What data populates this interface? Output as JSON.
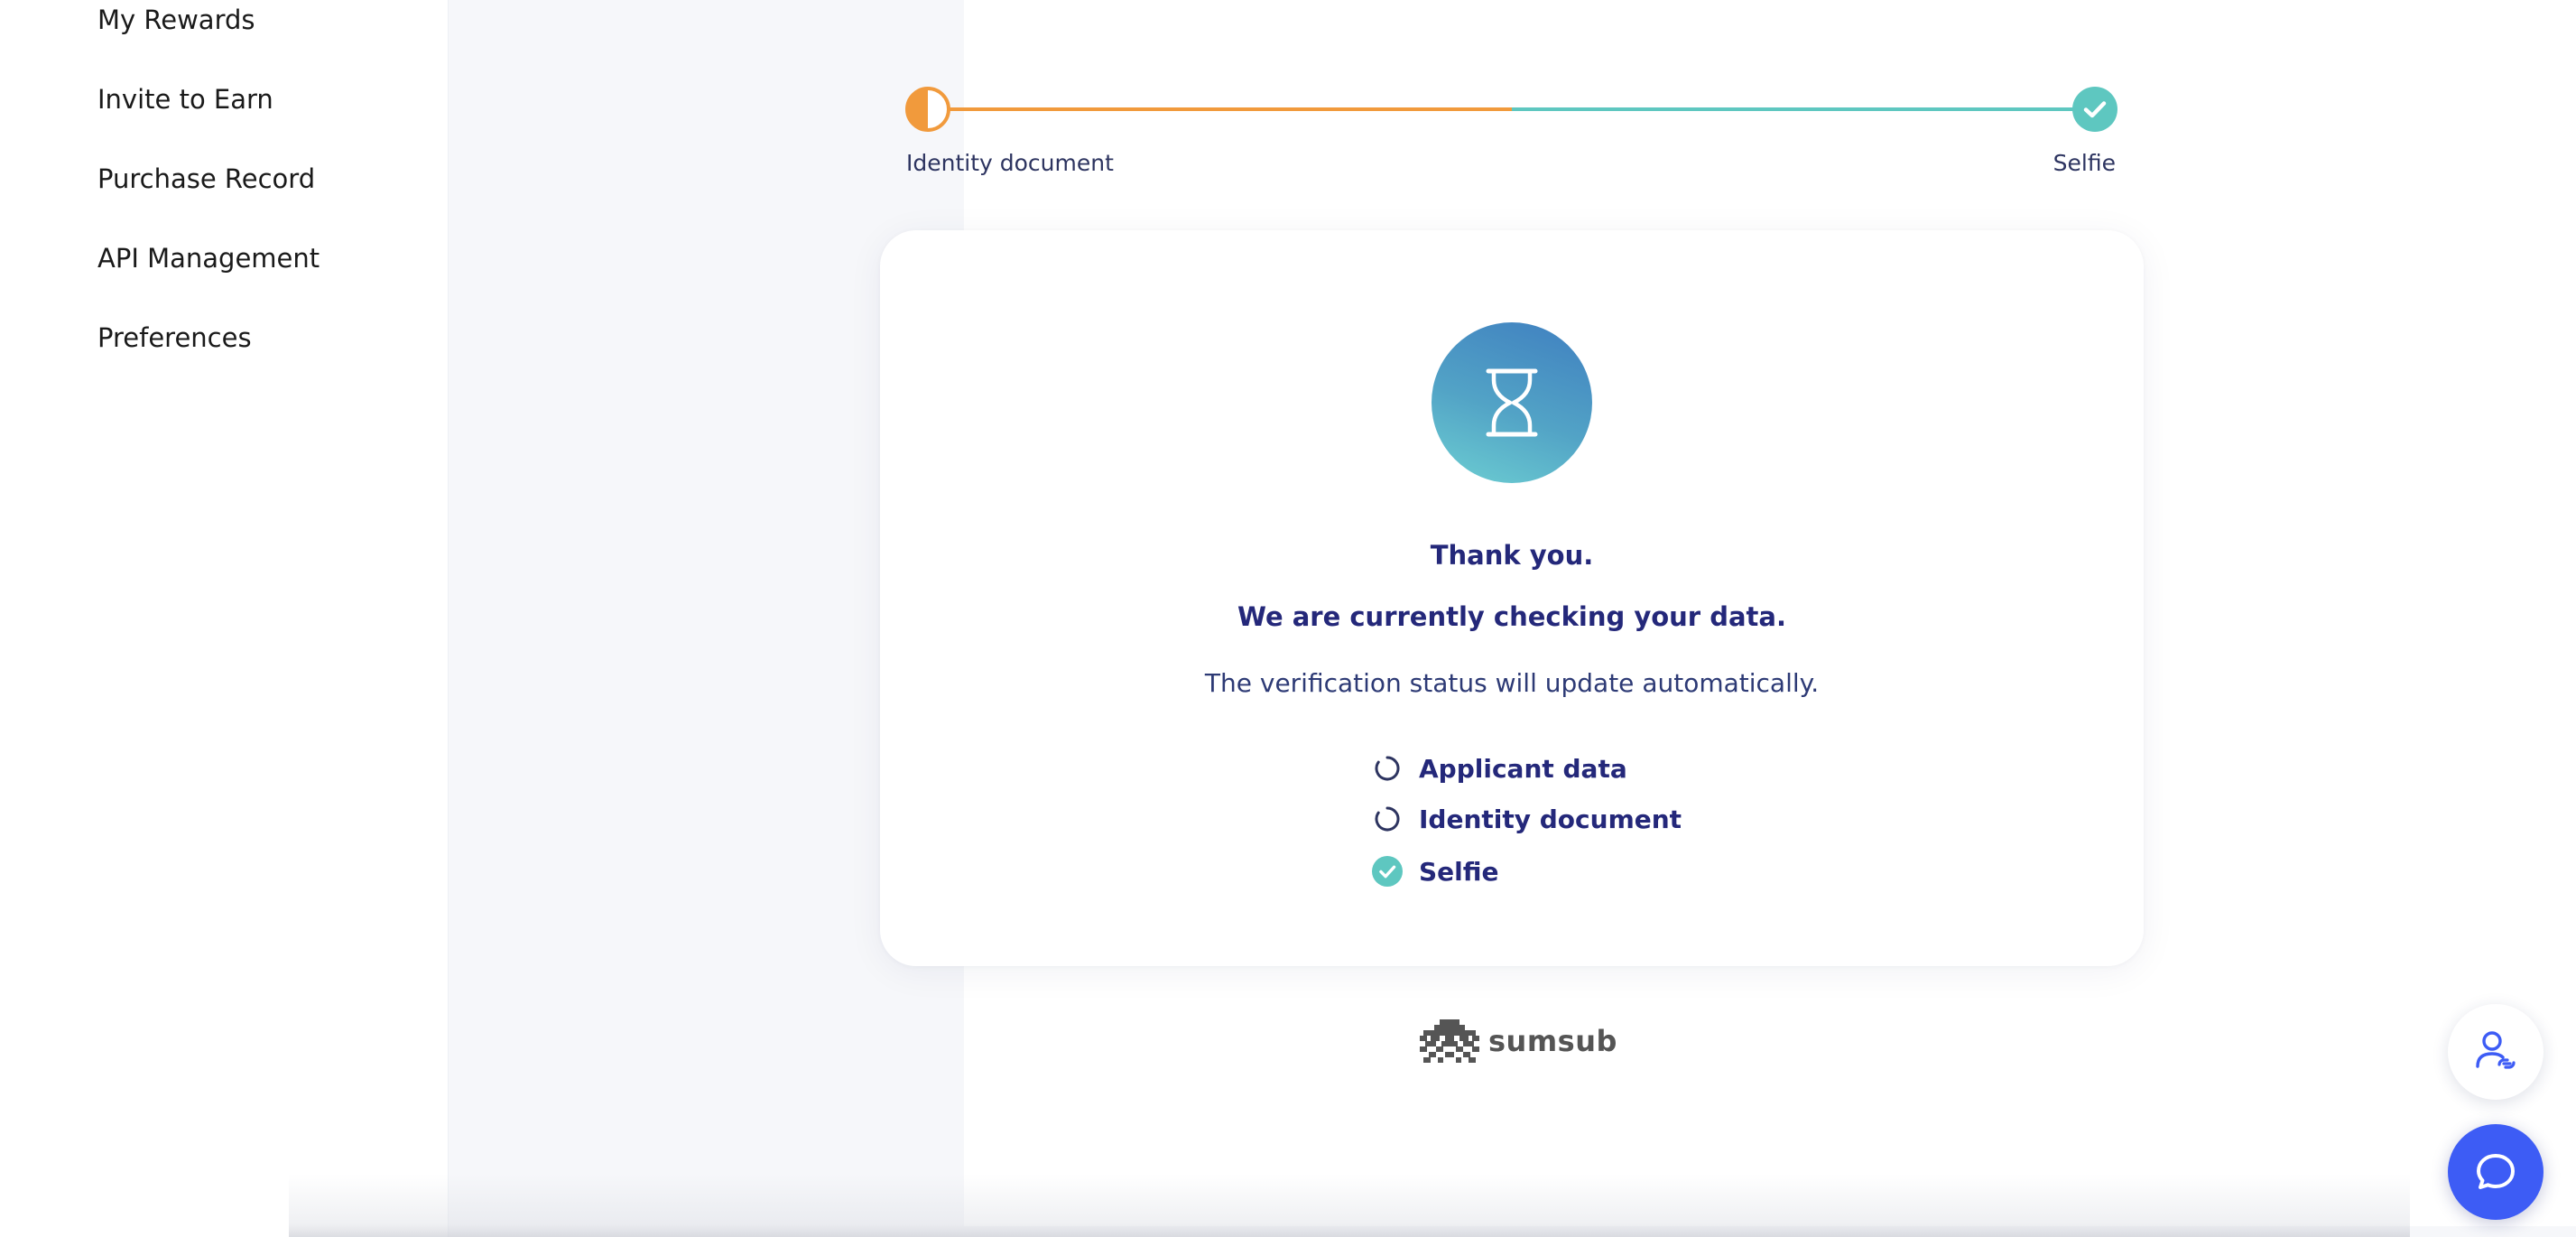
{
  "sidebar": {
    "items": [
      {
        "label": "My Rewards"
      },
      {
        "label": "Invite to Earn"
      },
      {
        "label": "Purchase Record"
      },
      {
        "label": "API Management"
      },
      {
        "label": "Preferences"
      }
    ]
  },
  "stepper": {
    "steps": [
      {
        "label": "Identity document",
        "state": "in-progress"
      },
      {
        "label": "Selfie",
        "state": "completed"
      }
    ]
  },
  "verification": {
    "icon": "hourglass-icon",
    "title": "Thank you.",
    "headline": "We are currently checking your data.",
    "message": "The verification status will update automatically.",
    "checklist": [
      {
        "label": "Applicant data",
        "status": "pending",
        "icon": "loading-ring-icon"
      },
      {
        "label": "Identity document",
        "status": "pending",
        "icon": "loading-ring-icon"
      },
      {
        "label": "Selfie",
        "status": "done",
        "icon": "check-circle-icon"
      }
    ]
  },
  "branding": {
    "logo_text": "sumsub"
  },
  "floating_actions": {
    "support_icon": "user-link-icon",
    "chat_icon": "chat-bubble-icon"
  },
  "colors": {
    "accent_orange": "#f19a3c",
    "accent_teal": "#5ec7c0",
    "text_navy": "#24287a",
    "chat_blue": "#3d5cf5"
  }
}
